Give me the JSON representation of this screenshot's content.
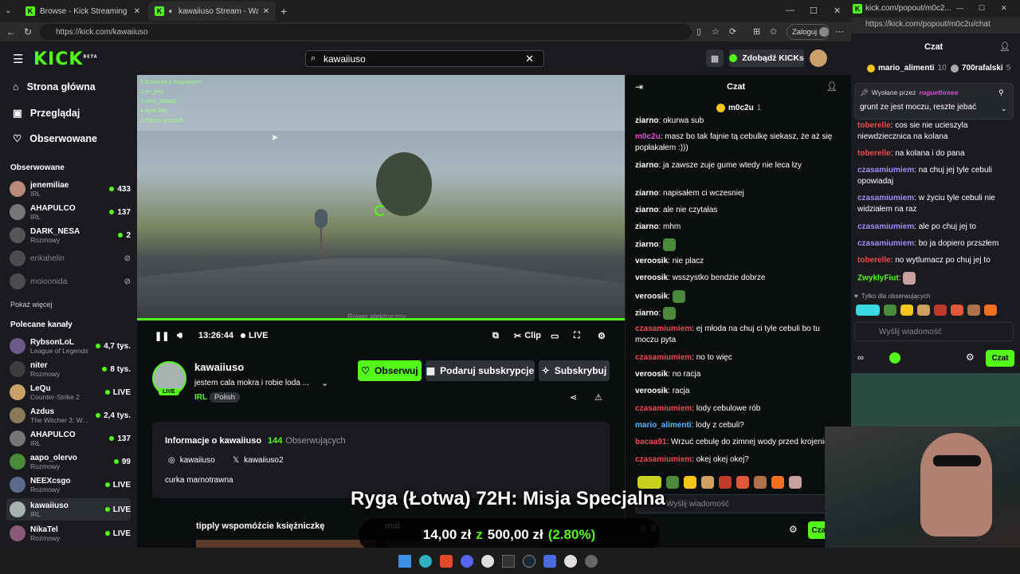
{
  "browser": {
    "tabs": [
      {
        "label": "Browse - Kick Streaming"
      },
      {
        "label": "kawaiiuso Stream - Watch Liv"
      }
    ],
    "url": "https://kick.com/kawaiiuso",
    "login_label": "Zaloguj"
  },
  "header": {
    "logo": "KICK",
    "logo_sup": "BETA",
    "search_value": "kawaiiuso",
    "cta_label": "Zdobądź KICKs"
  },
  "sidebar": {
    "nav": [
      {
        "label": "Strona główna"
      },
      {
        "label": "Przeglądaj"
      },
      {
        "label": "Obserwowane"
      }
    ],
    "followed_title": "Obserwowane",
    "followed": [
      {
        "name": "jenemiliae",
        "cat": "IRL",
        "viewers": "433"
      },
      {
        "name": "AHAPULCO",
        "cat": "IRL",
        "viewers": "137"
      },
      {
        "name": "DARK_NESA",
        "cat": "Rozmowy",
        "viewers": "2"
      },
      {
        "name": "erikahelin",
        "cat": "",
        "viewers": ""
      },
      {
        "name": "moioonida",
        "cat": "",
        "viewers": ""
      }
    ],
    "show_more": "Pokaż więcej",
    "recommended_title": "Polecane kanały",
    "recommended": [
      {
        "name": "RybsonLoL",
        "cat": "League of Legends",
        "viewers": "4,7 tys."
      },
      {
        "name": "niter",
        "cat": "Rozmowy",
        "viewers": "8 tys."
      },
      {
        "name": "LeQu",
        "cat": "Counter-Strike 2",
        "viewers": "LIVE"
      },
      {
        "name": "Azdus",
        "cat": "The Witcher 3: W...",
        "viewers": "2,4 tys."
      },
      {
        "name": "AHAPULCO",
        "cat": "IRL",
        "viewers": "137"
      },
      {
        "name": "aapo_olervo",
        "cat": "Rozmowy",
        "viewers": "99"
      },
      {
        "name": "NEEXcsgo",
        "cat": "Rozmowy",
        "viewers": "LIVE"
      },
      {
        "name": "kawaiiuso",
        "cat": "IRL",
        "viewers": "LIVE"
      },
      {
        "name": "NikaTel",
        "cat": "Rozmowy",
        "viewers": "LIVE"
      }
    ]
  },
  "player": {
    "time": "13:26:44",
    "live": "LIVE",
    "clip": "Clip",
    "overlay_lines": [
      "1.Kotnorka z Rogozinem",
      "2.en_jest",
      "3.Isles_Islands",
      "4.ByrKJMk",
      "5.Pijemy groszek"
    ],
    "overlay_bottom": "Rower elektryczny"
  },
  "streamer": {
    "name": "kawaiiuso",
    "title": "jestem cala mokra i robie loda ...",
    "category": "IRL",
    "language": "Polish",
    "live_badge": "LIVE",
    "follow": "Obserwuj",
    "gift": "Podaruj subskrypcje",
    "subscribe": "Subskrybuj"
  },
  "about": {
    "title": "Informacje o kawaiiuso",
    "followers": "144",
    "followers_label": "Obserwujących",
    "instagram": "kawaiiuso",
    "x": "kawaiiuso2",
    "bio": "curka marnotrawna",
    "next_title": "tipply wspomóżcie księżniczkę",
    "next_title2": "mal"
  },
  "chat": {
    "title": "Czat",
    "pinned_user": "m0c2u",
    "pinned_count": "1",
    "input_placeholder": "Wyślij wiadomość",
    "kicks": "0",
    "send": "Czat",
    "messages": [
      {
        "user": "ziarno",
        "color": "#ffffff",
        "text": "okurwa sub"
      },
      {
        "user": "m0c2u",
        "color": "#e44ad1",
        "text": "masz bo tak fajnie tą cebulkę siekasz, że aż się popłakałem :)))"
      },
      {
        "user": "ziarno",
        "color": "#ffffff",
        "text": "ja zawsze zuje gume wtedy nie leca łzy"
      },
      {
        "user": "ziarno",
        "color": "#ffffff",
        "text": "napisałem ci wczesniej"
      },
      {
        "user": "ziarno",
        "color": "#ffffff",
        "text": "ale nie czytałas"
      },
      {
        "user": "ziarno",
        "color": "#ffffff",
        "text": "mhm"
      },
      {
        "user": "ziarno",
        "color": "#ffffff",
        "text": ""
      },
      {
        "user": "veroosik",
        "color": "#ffffff",
        "text": "nie placz"
      },
      {
        "user": "veroosik",
        "color": "#ffffff",
        "text": "wsszystko bendzie dobrze"
      },
      {
        "user": "veroosik",
        "color": "#ffffff",
        "text": ""
      },
      {
        "user": "ziarno",
        "color": "#ffffff",
        "text": ""
      },
      {
        "user": "czasamiumiem",
        "color": "#f0494f",
        "text": "ej młoda na chuj ci tyle cebuli bo tu moczu pyta"
      },
      {
        "user": "czasamiumiem",
        "color": "#f0494f",
        "text": "no to więc"
      },
      {
        "user": "veroosik",
        "color": "#ffffff",
        "text": "no racja"
      },
      {
        "user": "veroosik",
        "color": "#ffffff",
        "text": "racja"
      },
      {
        "user": "czasamiumiem",
        "color": "#f0494f",
        "text": "lody cebulowe rób"
      },
      {
        "user": "mario_alimenti",
        "color": "#5ab4ff",
        "text": "lody z cebuli?"
      },
      {
        "user": "bacaa91",
        "color": "#f0494f",
        "text": "Wrzuć cebulę do zimnej wody przed krojenie"
      },
      {
        "user": "czasamiumiem",
        "color": "#f0494f",
        "text": "okej okej okej?"
      }
    ]
  },
  "popout": {
    "url_short": "kick.com/popout/m0c2...",
    "url": "https://kick.com/popout/m0c2u/chat",
    "title": "Czat",
    "top1_name": "mario_alimenti",
    "top1_count": "10",
    "top2_name": "700rafalski",
    "top2_count": "5",
    "pinned_by_label": "Wysłane przez",
    "pinned_by": "roguethreee",
    "pinned_text": "grunt ze jest moczu, reszte jebać",
    "messages": [
      {
        "user": "toberelle",
        "color": "#f0494f",
        "text": "cos sie nie ucieszyla niewdzieczniсa na kolana"
      },
      {
        "user": "toberelle",
        "color": "#f0494f",
        "text": "na kolana i do pana"
      },
      {
        "user": "czasamiumiem",
        "color": "#a78bfa",
        "text": "na chuj jej tyle cebuli opowiadaj"
      },
      {
        "user": "czasamiumiem",
        "color": "#a78bfa",
        "text": "w życiu tyle cebuli nie widziałem na raz"
      },
      {
        "user": "czasamiumiem",
        "color": "#a78bfa",
        "text": "ale po chuj jej to"
      },
      {
        "user": "czasamiumiem",
        "color": "#a78bfa",
        "text": "bo ja dopiero przszłem"
      },
      {
        "user": "toberelle",
        "color": "#f0494f",
        "text": "no wytlumacz po chuj jej to"
      },
      {
        "user": "ZwyklyFiut",
        "color": "#53fc18",
        "text": ""
      }
    ],
    "followers_only": "Tylko dla obserwujących",
    "input_placeholder": "Wyślij wiadomość",
    "send": "Czat"
  },
  "stream_overlay": {
    "title": "Ryga (Łotwa) 72H: Misja Specjalna",
    "amount": "14,00 zł",
    "z": "z",
    "goal": "500,00 zł",
    "pct": "(2.80%)"
  }
}
